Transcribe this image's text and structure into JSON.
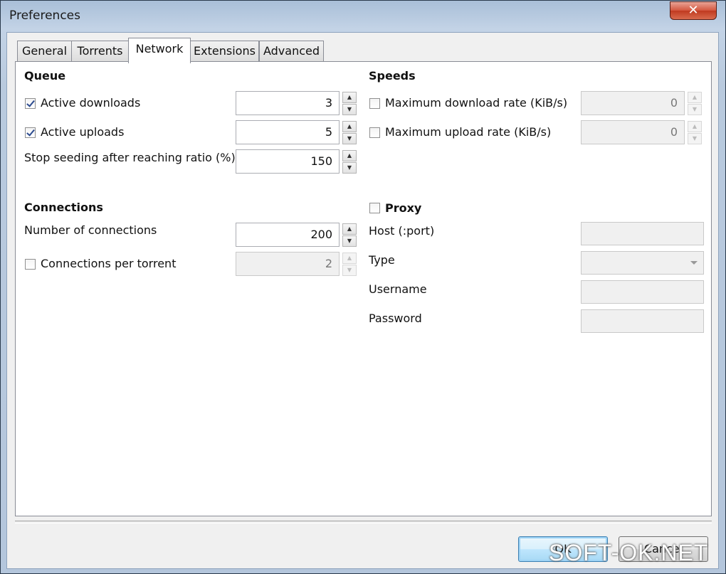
{
  "window": {
    "title": "Preferences",
    "close_glyph": "✕"
  },
  "tabs": [
    {
      "label": "General"
    },
    {
      "label": "Torrents"
    },
    {
      "label": "Network"
    },
    {
      "label": "Extensions"
    },
    {
      "label": "Advanced"
    }
  ],
  "active_tab": "Network",
  "queue": {
    "heading": "Queue",
    "active_downloads": {
      "label": "Active downloads",
      "checked": true,
      "value": "3"
    },
    "active_uploads": {
      "label": "Active uploads",
      "checked": true,
      "value": "5"
    },
    "stop_seeding": {
      "label": "Stop seeding after reaching ratio (%)",
      "value": "150"
    }
  },
  "speeds": {
    "heading": "Speeds",
    "max_download": {
      "label": "Maximum download rate (KiB/s)",
      "checked": false,
      "value": "0"
    },
    "max_upload": {
      "label": "Maximum upload rate (KiB/s)",
      "checked": false,
      "value": "0"
    }
  },
  "connections": {
    "heading": "Connections",
    "number": {
      "label": "Number of connections",
      "value": "200"
    },
    "per_torrent": {
      "label": "Connections per torrent",
      "checked": false,
      "value": "2"
    }
  },
  "proxy": {
    "heading": "Proxy",
    "checked": false,
    "host_label": "Host (:port)",
    "type_label": "Type",
    "username_label": "Username",
    "password_label": "Password"
  },
  "buttons": {
    "ok": "OK",
    "cancel": "Cancel"
  },
  "watermark": "SOFT-OK.NET"
}
